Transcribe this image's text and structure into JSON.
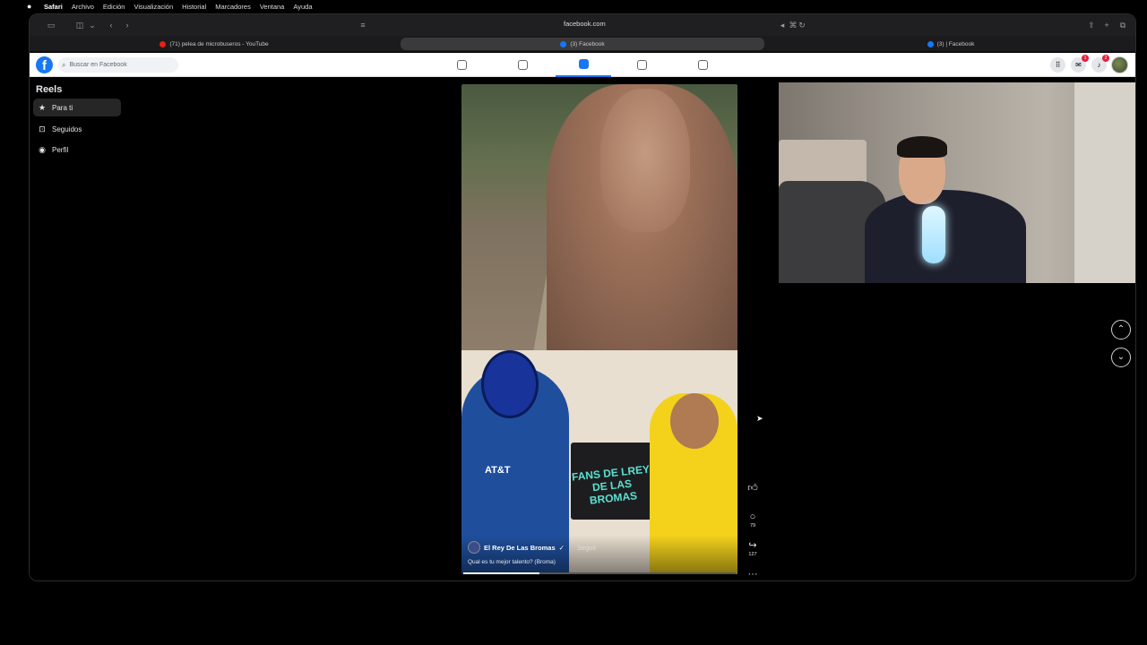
{
  "menubar": {
    "apple": "",
    "app": "Safari",
    "items": [
      "Archivo",
      "Edición",
      "Visualización",
      "Historial",
      "Marcadores",
      "Ventana",
      "Ayuda"
    ]
  },
  "browser": {
    "url": "facebook.com",
    "tabs": [
      {
        "label": "(71) pelea de microbuseros - YouTube",
        "icon": "youtube-icon"
      },
      {
        "label": "(3) Facebook",
        "icon": "facebook-icon",
        "active": true
      },
      {
        "label": "(3) | Facebook",
        "icon": "facebook-icon"
      }
    ]
  },
  "facebook": {
    "logo": "f",
    "search_placeholder": "Buscar en Facebook",
    "nav_icons": [
      "home-icon",
      "video-icon",
      "reels-icon",
      "marketplace-icon",
      "gaming-icon"
    ],
    "messenger_badge": "1",
    "notifications_badge": "2"
  },
  "sidebar": {
    "title": "Reels",
    "items": [
      {
        "label": "Para ti",
        "icon": "★"
      },
      {
        "label": "Seguidos",
        "icon": "⊡"
      },
      {
        "label": "Perfil",
        "icon": "◉"
      }
    ]
  },
  "reel": {
    "author": "El Rey De Las Bromas",
    "follow": "Seguir",
    "caption": "Qual es tu mejor talento? (Broma)",
    "overlay_text_left": "AT&T",
    "overlay_text_sign": "FANS DE LREY DE LAS BROMAS",
    "progress": 0.28,
    "actions": {
      "like": "",
      "comments": "79",
      "shares": "127",
      "more": "···"
    }
  },
  "colors": {
    "facebook_blue": "#1877f2",
    "badge_red": "#e41e3f"
  }
}
